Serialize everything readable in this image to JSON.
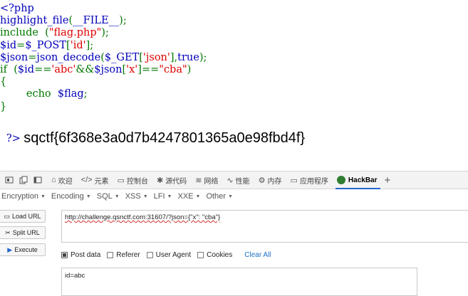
{
  "source": {
    "lines": [
      [
        {
          "t": "<?php",
          "c": "def"
        }
      ],
      [
        {
          "t": "highlight_file",
          "c": "def"
        },
        {
          "t": "(",
          "c": "kw"
        },
        {
          "t": "__FILE__",
          "c": "def"
        },
        {
          "t": ");",
          "c": "kw"
        }
      ],
      [
        {
          "t": "include  ",
          "c": "kw"
        },
        {
          "t": "(",
          "c": "kw"
        },
        {
          "t": "\"flag.php\"",
          "c": "str"
        },
        {
          "t": ");",
          "c": "kw"
        }
      ],
      [
        {
          "t": "$id",
          "c": "def"
        },
        {
          "t": "=",
          "c": "kw"
        },
        {
          "t": "$_POST",
          "c": "def"
        },
        {
          "t": "[",
          "c": "kw"
        },
        {
          "t": "'id'",
          "c": "str"
        },
        {
          "t": "];",
          "c": "kw"
        }
      ],
      [
        {
          "t": "$json",
          "c": "def"
        },
        {
          "t": "=",
          "c": "kw"
        },
        {
          "t": "json_decode",
          "c": "def"
        },
        {
          "t": "(",
          "c": "kw"
        },
        {
          "t": "$_GET",
          "c": "def"
        },
        {
          "t": "[",
          "c": "kw"
        },
        {
          "t": "'json'",
          "c": "str"
        },
        {
          "t": "],",
          "c": "kw"
        },
        {
          "t": "true",
          "c": "def"
        },
        {
          "t": ");",
          "c": "kw"
        }
      ],
      [
        {
          "t": "if  ",
          "c": "kw"
        },
        {
          "t": "(",
          "c": "kw"
        },
        {
          "t": "$id",
          "c": "def"
        },
        {
          "t": "==",
          "c": "kw"
        },
        {
          "t": "'abc'",
          "c": "str"
        },
        {
          "t": "&&",
          "c": "kw"
        },
        {
          "t": "$json",
          "c": "def"
        },
        {
          "t": "[",
          "c": "kw"
        },
        {
          "t": "'x'",
          "c": "str"
        },
        {
          "t": "]==",
          "c": "kw"
        },
        {
          "t": "\"cba\"",
          "c": "str"
        },
        {
          "t": ")",
          "c": "kw"
        }
      ],
      [
        {
          "t": "{",
          "c": "kw"
        }
      ],
      [
        {
          "t": "        echo  ",
          "c": "kw"
        },
        {
          "t": "$flag",
          "c": "def"
        },
        {
          "t": ";",
          "c": "kw"
        }
      ],
      [
        {
          "t": "}",
          "c": "kw"
        }
      ]
    ],
    "close_tag": "?>",
    "flag_output": "sqctf{6f368e3a0d7b4247801365a0e98fbd4f}",
    "colors": {
      "def": "#0000bb",
      "kw": "#007700",
      "str": "#dd0000"
    }
  },
  "devtools": {
    "tabs": [
      {
        "icon": "⌂",
        "label": "欢迎"
      },
      {
        "icon": "</>",
        "label": "元素"
      },
      {
        "icon": "▭",
        "label": "控制台"
      },
      {
        "icon": "✱",
        "label": "源代码"
      },
      {
        "icon": "≋",
        "label": "网络"
      },
      {
        "icon": "∿",
        "label": "性能"
      },
      {
        "icon": "⚙",
        "label": "内存"
      },
      {
        "icon": "▭",
        "label": "应用程序"
      }
    ],
    "active_tab": "HackBar",
    "add_tab": "+"
  },
  "hackbar": {
    "menu": [
      "Encryption",
      "Encoding",
      "SQL",
      "XSS",
      "LFI",
      "XXE",
      "Other"
    ],
    "buttons": {
      "load": "Load URL",
      "split": "Split URL",
      "execute": "Execute"
    },
    "url_value": "http://challenge.qsnctf.com:31607/?json={\"x\": \"cba\"}",
    "options": [
      {
        "label": "Post data",
        "checked": true
      },
      {
        "label": "Referer",
        "checked": false
      },
      {
        "label": "User Agent",
        "checked": false
      },
      {
        "label": "Cookies",
        "checked": false
      }
    ],
    "clear_all": "Clear All",
    "post_value": "id=abc"
  }
}
